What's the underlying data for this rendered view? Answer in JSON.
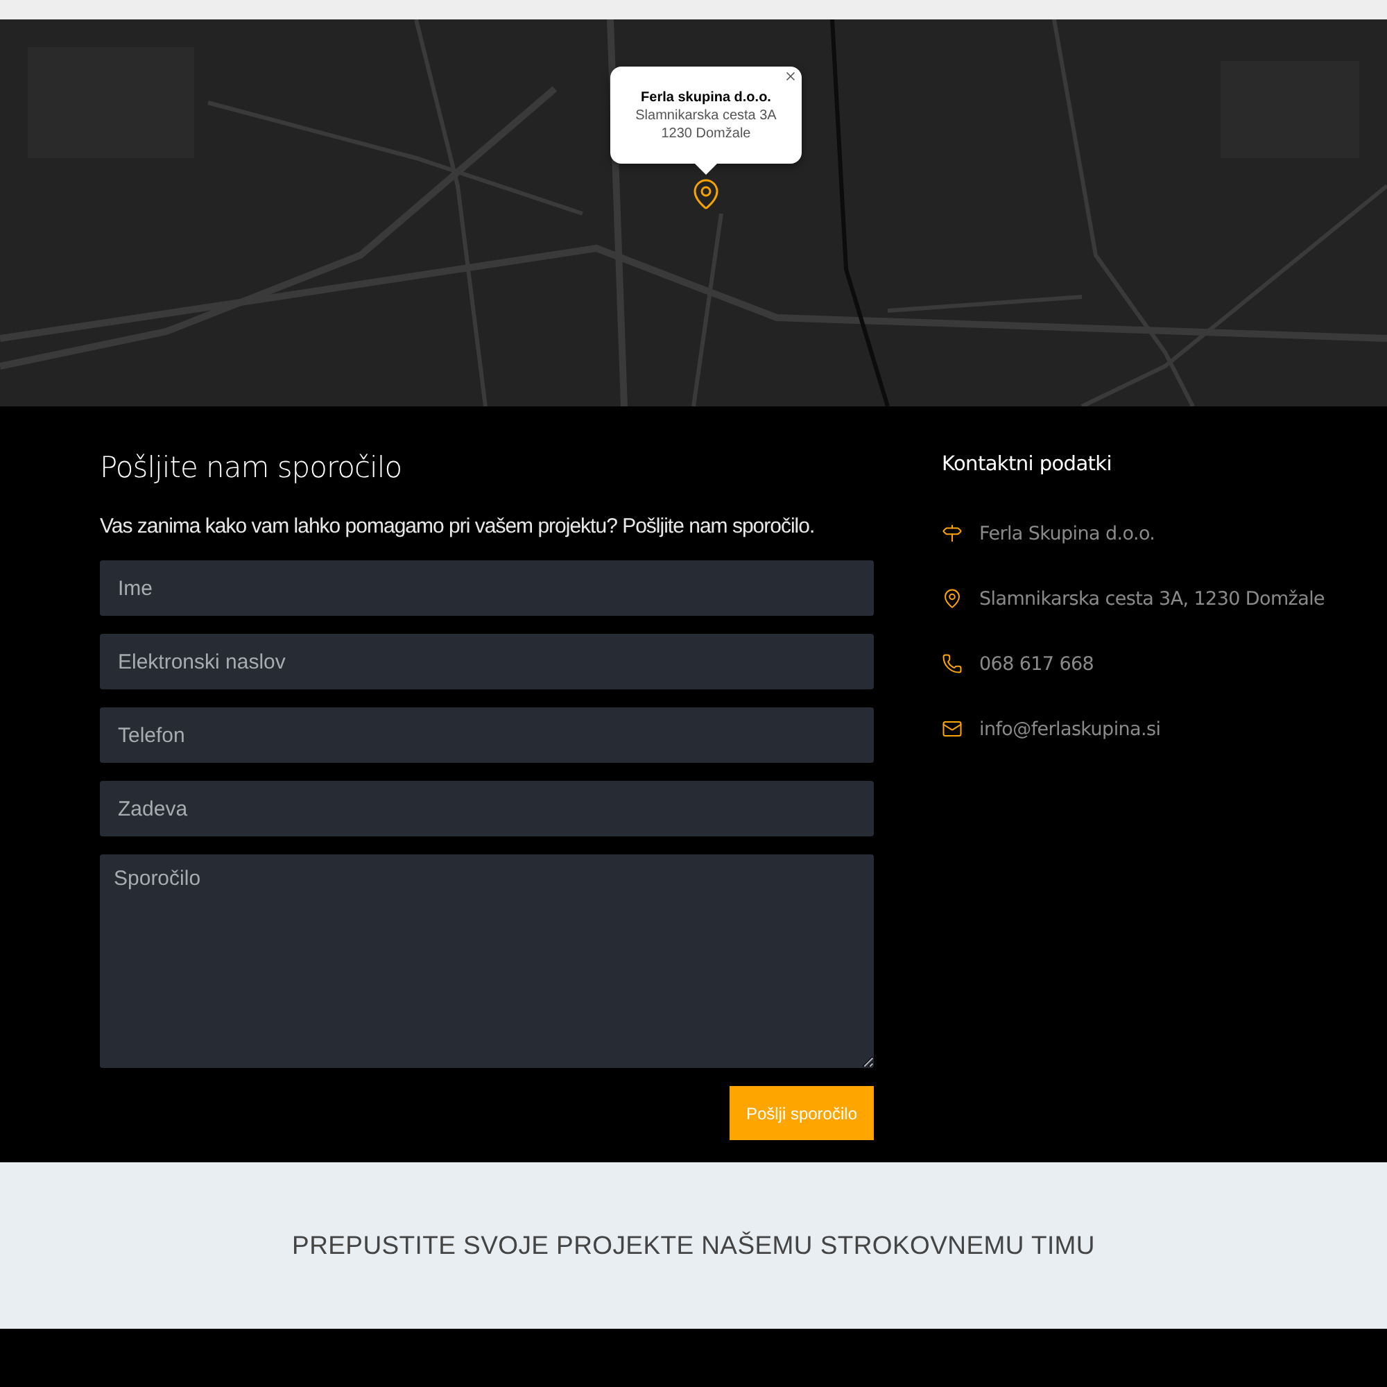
{
  "map": {
    "popup": {
      "title": "Ferla skupina d.o.o.",
      "lines": [
        "Slamnikarska cesta 3A",
        "1230 Domžale"
      ]
    }
  },
  "form": {
    "title": "Pošljite nam sporočilo",
    "intro": "Vas zanima kako vam lahko pomagamo pri vašem projektu? Pošljite nam sporočilo.",
    "fields": [
      {
        "kind": "input",
        "placeholder": "Ime"
      },
      {
        "kind": "input",
        "placeholder": "Elektronski naslov"
      },
      {
        "kind": "input",
        "placeholder": "Telefon"
      },
      {
        "kind": "input",
        "placeholder": "Zadeva"
      },
      {
        "kind": "textarea",
        "placeholder": "Sporočilo"
      }
    ],
    "submit": "Pošlji sporočilo"
  },
  "contact": {
    "title": "Kontaktni podatki",
    "items": [
      {
        "kind": "company",
        "text": "Ferla Skupina d.o.o."
      },
      {
        "kind": "address",
        "text": "Slamnikarska cesta 3A, 1230 Domžale"
      },
      {
        "kind": "phone",
        "text": "068 617 668"
      },
      {
        "kind": "email",
        "text": "info@ferlaskupina.si"
      }
    ]
  },
  "banner": {
    "title": "PREPUSTITE SVOJE PROJEKTE NAŠEMU STROKOVNEMU TIMU"
  }
}
